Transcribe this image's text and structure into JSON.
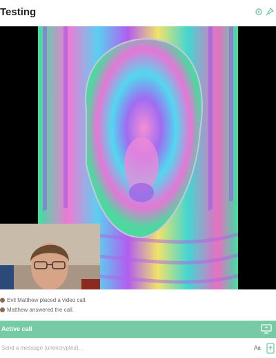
{
  "room": {
    "title": "Testing"
  },
  "header": {
    "icons": [
      "settings-icon",
      "pin-icon"
    ]
  },
  "events": [
    {
      "text": "Evil Matthew placed a video call."
    },
    {
      "text": "Matthew answered the call."
    }
  ],
  "call": {
    "label": "Active call",
    "icon": "screen-share-icon"
  },
  "composer": {
    "placeholder": "Send a message (unencrypted)…",
    "format_label": "Aa",
    "icon": "attach-icon"
  },
  "colors": {
    "accent": "#76cba5"
  }
}
